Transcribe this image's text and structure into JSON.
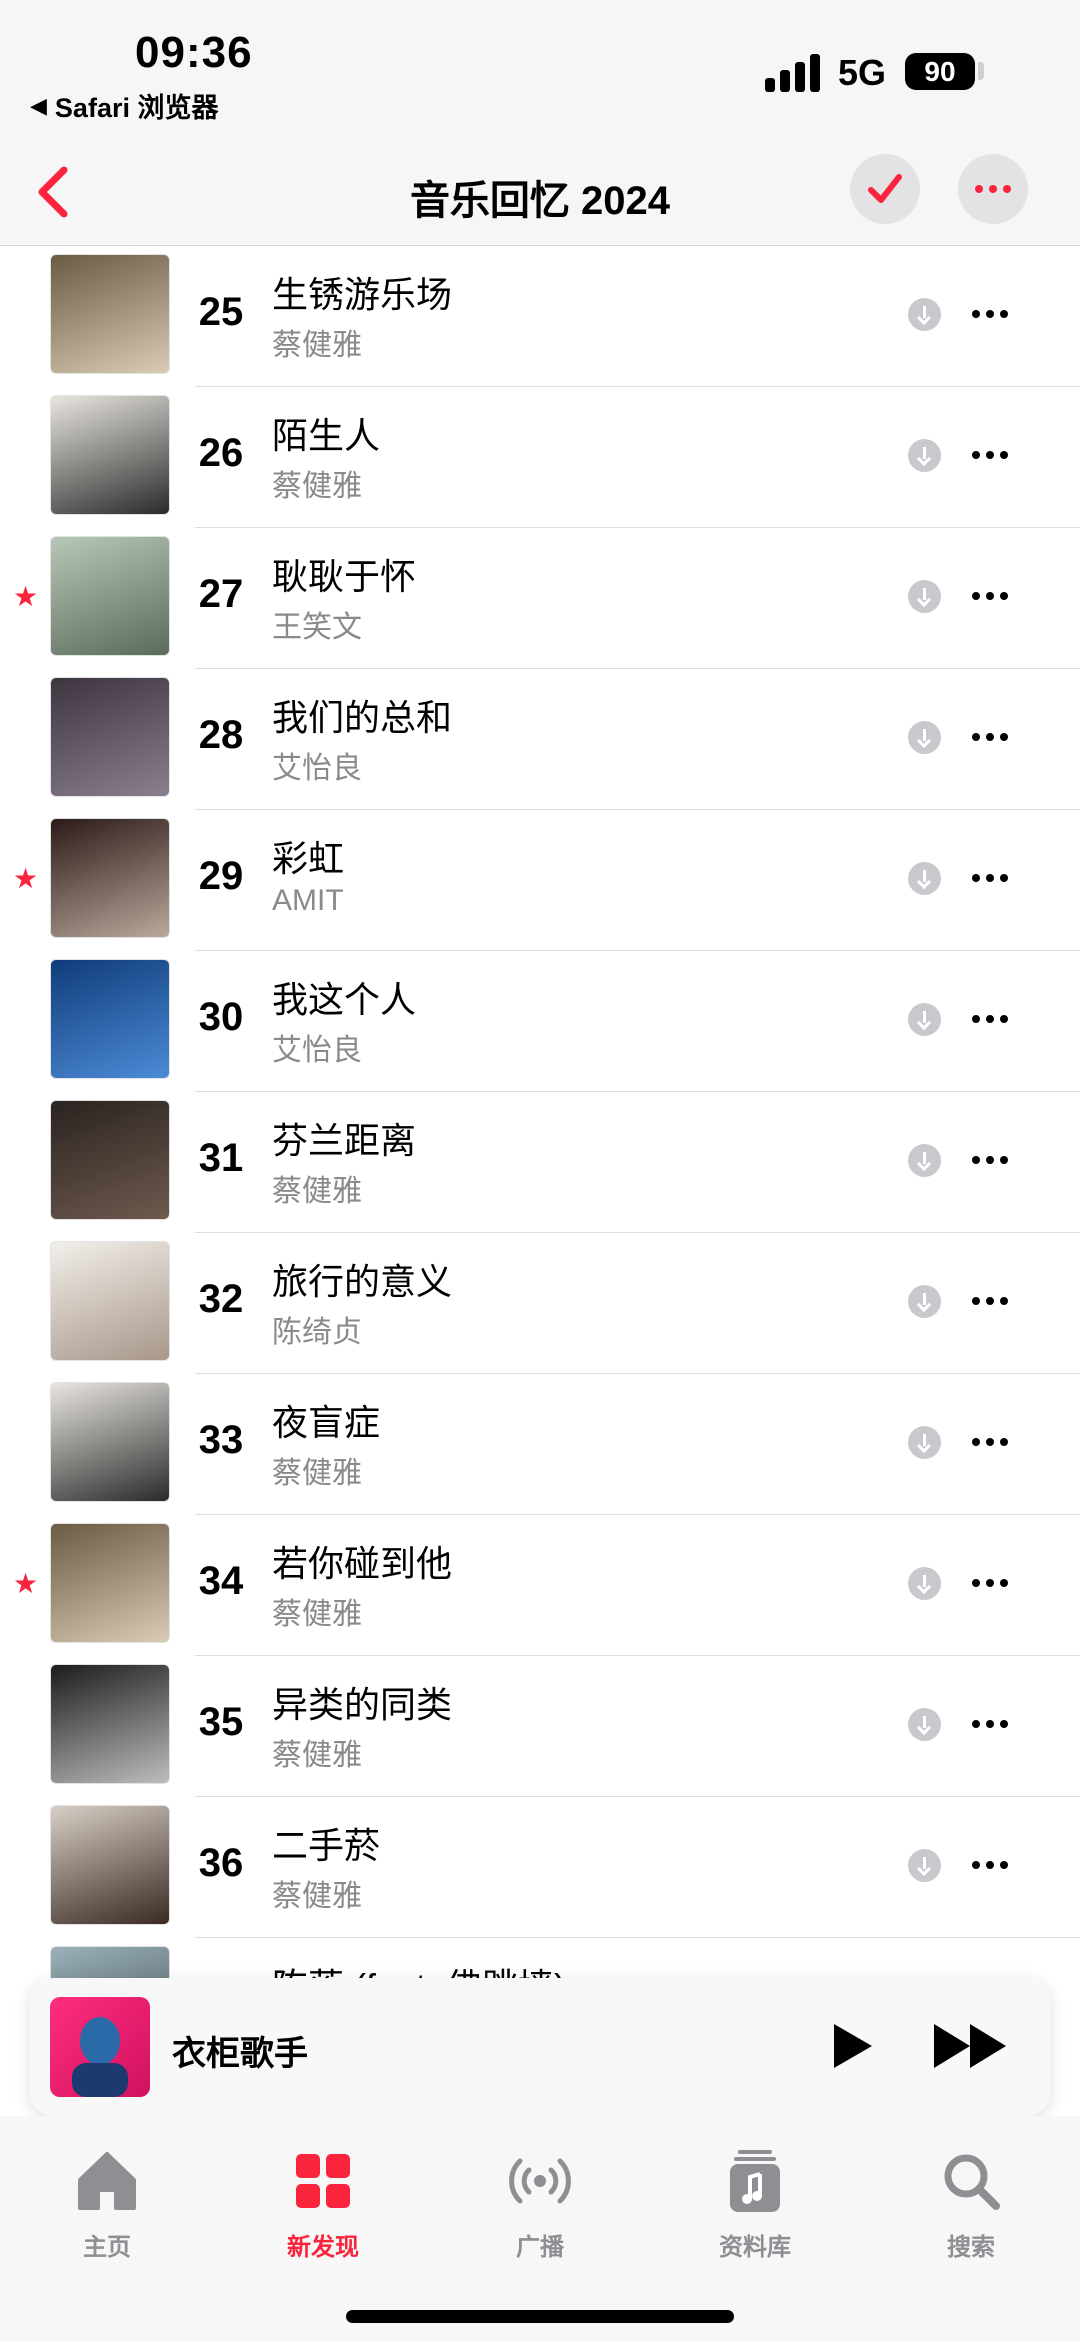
{
  "status_bar": {
    "time": "09:36",
    "back_app": "Safari 浏览器",
    "network": "5G",
    "battery": "90"
  },
  "nav": {
    "title": "音乐回忆 2024"
  },
  "colors": {
    "accent": "#fa243c",
    "secondary_text": "#8a8a8e"
  },
  "songs": [
    {
      "rank": "25",
      "title": "生锈游乐场",
      "artist": "蔡健雅",
      "starred": false
    },
    {
      "rank": "26",
      "title": "陌生人",
      "artist": "蔡健雅",
      "starred": false
    },
    {
      "rank": "27",
      "title": "耿耿于怀",
      "artist": "王笑文",
      "starred": true
    },
    {
      "rank": "28",
      "title": "我们的总和",
      "artist": "艾怡良",
      "starred": false
    },
    {
      "rank": "29",
      "title": "彩虹",
      "artist": "AMIT",
      "starred": true
    },
    {
      "rank": "30",
      "title": "我这个人",
      "artist": "艾怡良",
      "starred": false
    },
    {
      "rank": "31",
      "title": "芬兰距离",
      "artist": "蔡健雅",
      "starred": false
    },
    {
      "rank": "32",
      "title": "旅行的意义",
      "artist": "陈绮贞",
      "starred": false
    },
    {
      "rank": "33",
      "title": "夜盲症",
      "artist": "蔡健雅",
      "starred": false
    },
    {
      "rank": "34",
      "title": "若你碰到他",
      "artist": "蔡健雅",
      "starred": true
    },
    {
      "rank": "35",
      "title": "异类的同类",
      "artist": "蔡健雅",
      "starred": false
    },
    {
      "rank": "36",
      "title": "二手菸",
      "artist": "蔡健雅",
      "starred": false
    },
    {
      "rank": "",
      "title": "陈落 (feat. 佛跳墙)",
      "artist": "",
      "starred": false
    }
  ],
  "now_playing": {
    "title": "衣柜歌手"
  },
  "tabs": [
    {
      "label": "主页",
      "icon": "home-icon",
      "active": false
    },
    {
      "label": "新发现",
      "icon": "grid-icon",
      "active": true
    },
    {
      "label": "广播",
      "icon": "radio-icon",
      "active": false
    },
    {
      "label": "资料库",
      "icon": "library-icon",
      "active": false
    },
    {
      "label": "搜索",
      "icon": "search-icon",
      "active": false
    }
  ]
}
